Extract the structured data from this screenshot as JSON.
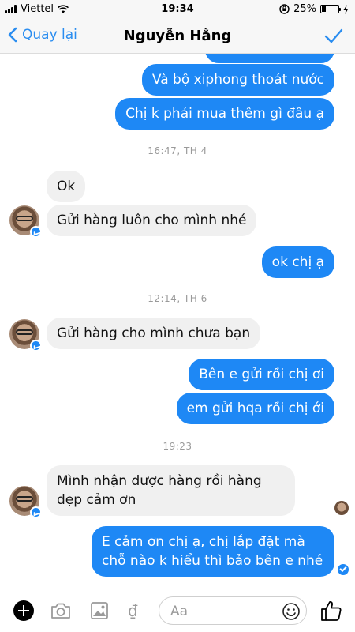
{
  "status_bar": {
    "carrier": "Viettel",
    "time": "19:34",
    "battery_percent": "25%",
    "battery_level": 0.25
  },
  "nav": {
    "back_label": "Quay lại",
    "title": "Nguyễn Hằng"
  },
  "messages": [
    {
      "type": "outgoing",
      "text": "Và bộ xiphong thoát nước"
    },
    {
      "type": "outgoing",
      "text": "Chị k phải mua thêm gì đâu ạ"
    },
    {
      "type": "timestamp",
      "text": "16:47, TH 4"
    },
    {
      "type": "incoming",
      "text": "Ok"
    },
    {
      "type": "incoming",
      "text": "Gửi hàng luôn cho mình nhé"
    },
    {
      "type": "outgoing",
      "text": "ok chị ạ"
    },
    {
      "type": "timestamp",
      "text": "12:14, TH 6"
    },
    {
      "type": "incoming",
      "text": "Gửi hàng cho mình chưa bạn"
    },
    {
      "type": "outgoing",
      "text": "Bên e gửi rồi chị ơi"
    },
    {
      "type": "outgoing",
      "text": "em gửi hqa rồi chị ới"
    },
    {
      "type": "timestamp",
      "text": "19:23"
    },
    {
      "type": "incoming",
      "text": "Mình nhận được hàng rồi hàng đẹp cảm ơn"
    },
    {
      "type": "outgoing",
      "text": "E cảm ơn chị ạ, chị lắp đặt mà chỗ nào k hiểu thì  bảo bên e nhé"
    }
  ],
  "composer": {
    "placeholder": "Aa",
    "currency_symbol": "₫"
  },
  "icons": {
    "add": "plus-circle-icon",
    "camera": "camera-icon",
    "gallery": "image-icon",
    "emoji": "smiley-icon",
    "like": "thumbs-up-icon",
    "send_check": "check-icon"
  },
  "colors": {
    "accent": "#1e88f5",
    "incoming_bubble": "#f0f0f0",
    "timestamp": "#9a9a9a"
  }
}
